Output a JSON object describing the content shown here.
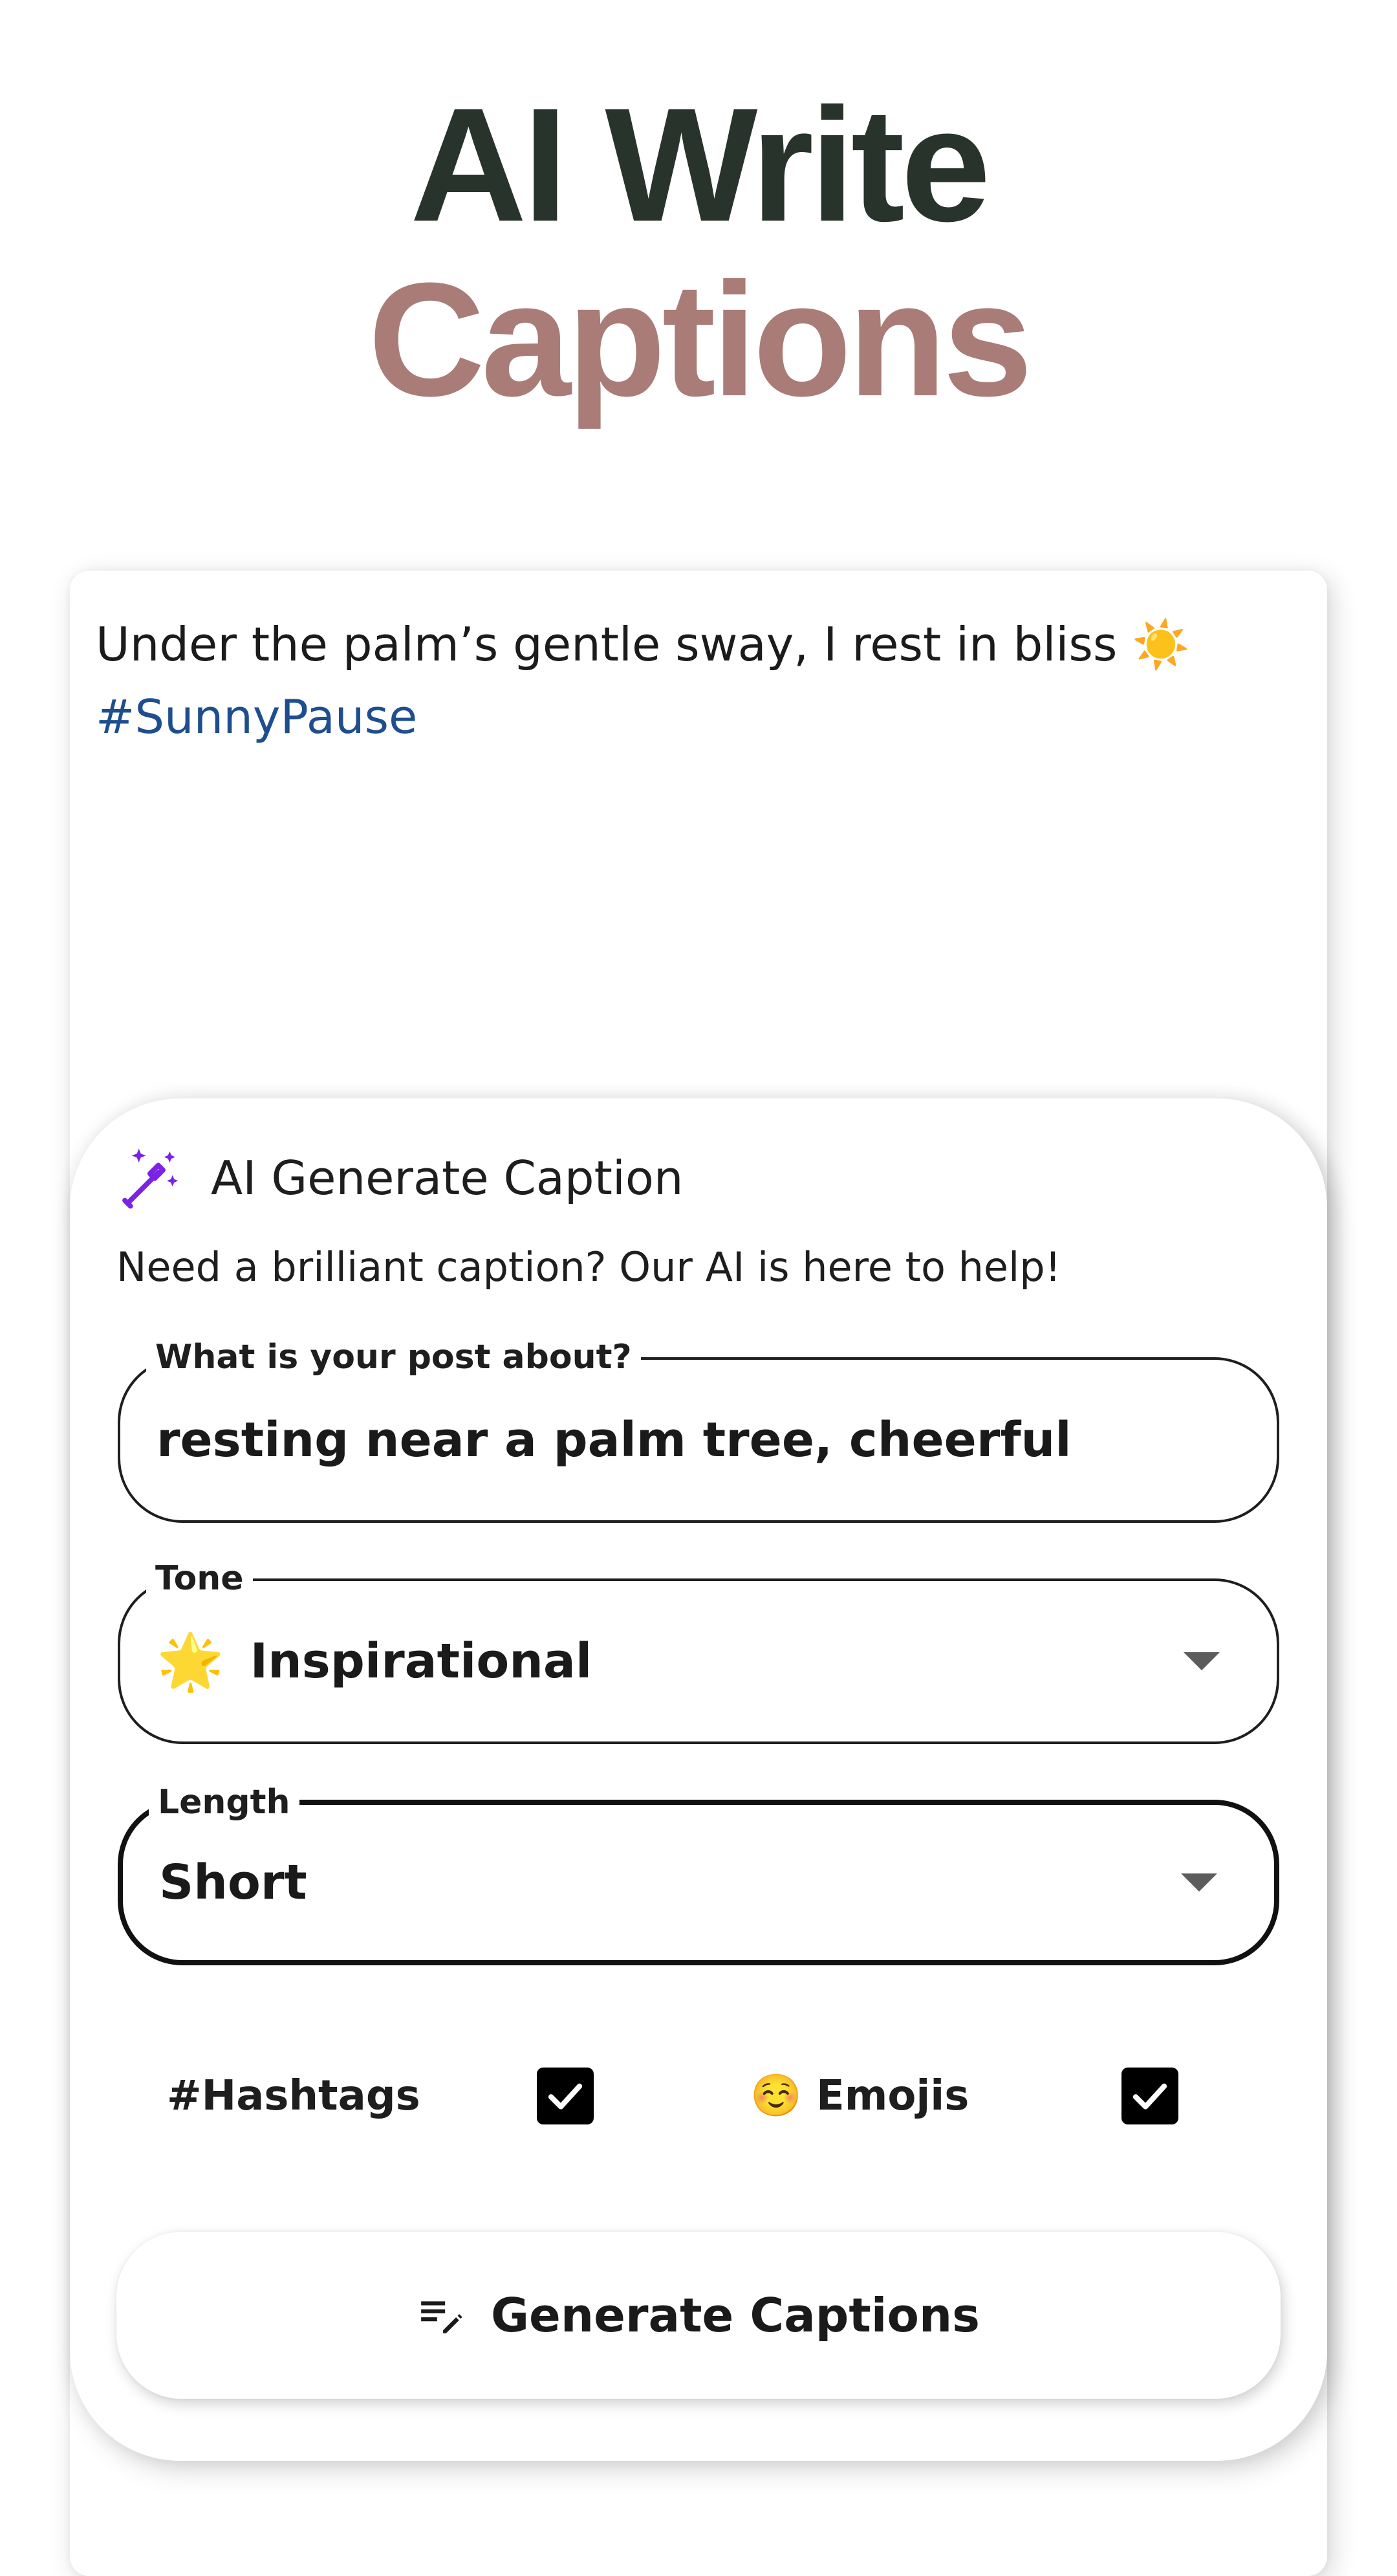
{
  "title": {
    "line1": "AI Write",
    "line2": "Captions"
  },
  "caption": {
    "text": "Under the palm’s gentle sway, I rest in bliss",
    "emoji": "☀️",
    "hashtag": "#SunnyPause"
  },
  "panel": {
    "icon": "magic-wand-icon",
    "title": "AI Generate Caption",
    "subtitle": "Need a brilliant caption? Our AI is here to help!"
  },
  "fields": {
    "post_about": {
      "label": "What is your post about?",
      "value": "resting near a palm tree, cheerful"
    },
    "tone": {
      "label": "Tone",
      "emoji": "🌟",
      "value": "Inspirational"
    },
    "length": {
      "label": "Length",
      "value": "Short"
    }
  },
  "options": {
    "hashtags": {
      "label": "#Hashtags",
      "checked": true
    },
    "emojis": {
      "emoji": "☺️",
      "label": "Emojis",
      "checked": true
    }
  },
  "generate_button": {
    "icon": "edit-notes-icon",
    "label": "Generate Captions"
  },
  "colors": {
    "title_dark": "#28342b",
    "title_rose": "#a97c78",
    "hashtag": "#1f4e8f",
    "wand_purple": "#7b22e6",
    "checkbox": "#000000"
  }
}
